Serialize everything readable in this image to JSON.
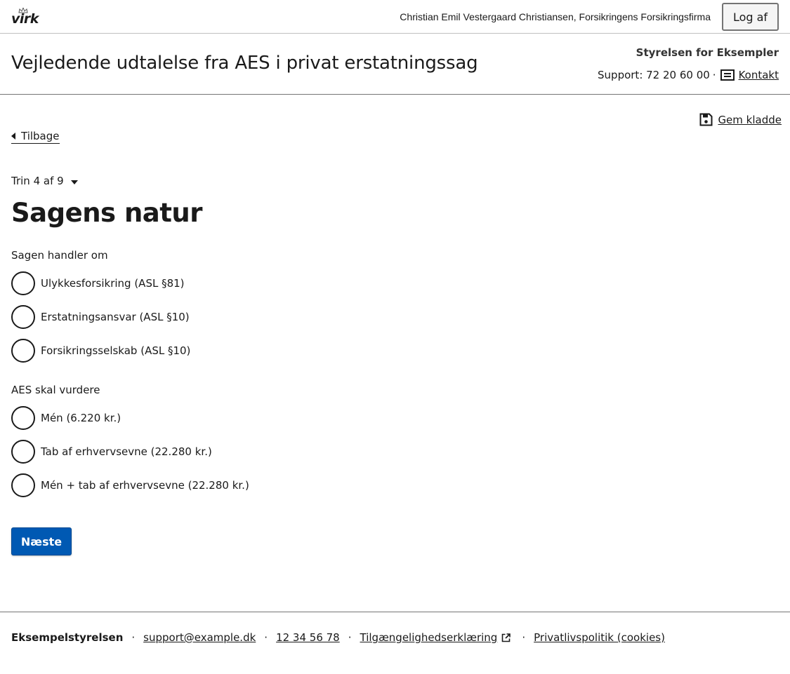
{
  "topbar": {
    "logo_text": "virk",
    "user": "Christian Emil Vestergaard Christiansen, Forsikringens Forsikringsfirma",
    "logout_label": "Log af"
  },
  "header": {
    "title": "Vejledende udtalelse fra AES i privat erstatningssag",
    "authority": "Styrelsen for Eksempler",
    "support_label": "Support: 72 20 60 00",
    "support_sep": "·",
    "contact_label": "Kontakt"
  },
  "nav": {
    "save_draft_label": "Gem kladde",
    "back_label": "Tilbage",
    "step_label": "Trin 4 af 9"
  },
  "form": {
    "title": "Sagens natur",
    "groups": [
      {
        "legend": "Sagen handler om",
        "options": [
          "Ulykkesforsikring (ASL §81)",
          "Erstatningsansvar (ASL §10)",
          "Forsikringsselskab (ASL §10)"
        ]
      },
      {
        "legend": "AES skal vurdere",
        "options": [
          "Mén (6.220 kr.)",
          "Tab af erhvervsevne (22.280 kr.)",
          "Mén + tab af erhvervsevne (22.280 kr.)"
        ]
      }
    ],
    "next_label": "Næste"
  },
  "footer": {
    "org": "Eksempelstyrelsen",
    "email": "support@example.dk",
    "phone": "12 34 56 78",
    "accessibility": "Tilgængelighedserklæring",
    "privacy": "Privatlivspolitik (cookies)",
    "sep": "·"
  },
  "colors": {
    "primary_button": "#0059b3",
    "text": "#1a1a1a",
    "divider": "#747474"
  },
  "icons": [
    "crown-icon",
    "contact-card-icon",
    "save-disk-icon",
    "back-caret-icon",
    "dropdown-caret-icon",
    "external-link-icon"
  ]
}
